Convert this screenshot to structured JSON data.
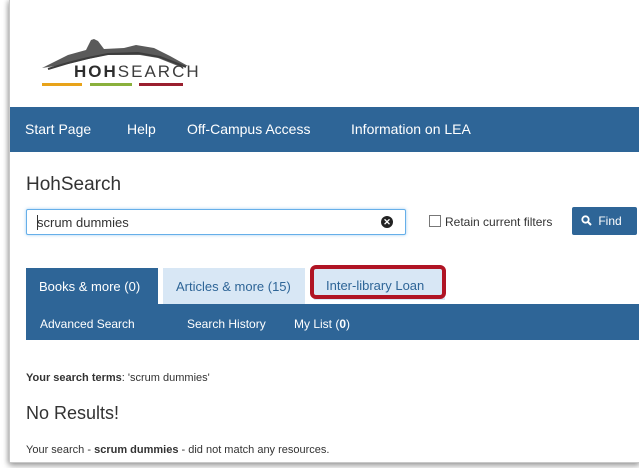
{
  "logo": {
    "text_bold": "HOH",
    "text_rest": "SEARCH",
    "bar_colors": [
      "#e8a31a",
      "#8ab03c",
      "#9a1f2e"
    ]
  },
  "nav": {
    "items": [
      "Start Page",
      "Help",
      "Off-Campus Access",
      "Information on LEA"
    ]
  },
  "page_title": "HohSearch",
  "search": {
    "value": "scrum dummies",
    "retain_label": "Retain current filters",
    "find_label": "Find"
  },
  "tabs": {
    "books": "Books & more (0)",
    "articles": "Articles & more (15)",
    "loan": "Inter-library Loan"
  },
  "subnav": {
    "advanced": "Advanced Search",
    "history": "Search History",
    "mylist_label": "My List (",
    "mylist_count": "0",
    "mylist_close": ")"
  },
  "results": {
    "terms_label": "Your search terms",
    "terms_value": ": 'scrum dummies'",
    "no_results": "No Results!",
    "msg_prefix": "Your search - ",
    "msg_query": "scrum dummies",
    "msg_suffix": " - did not match any resources."
  },
  "colors": {
    "primary": "#2e6597",
    "tab_light": "#d8e7f5",
    "highlight": "#b01424"
  }
}
